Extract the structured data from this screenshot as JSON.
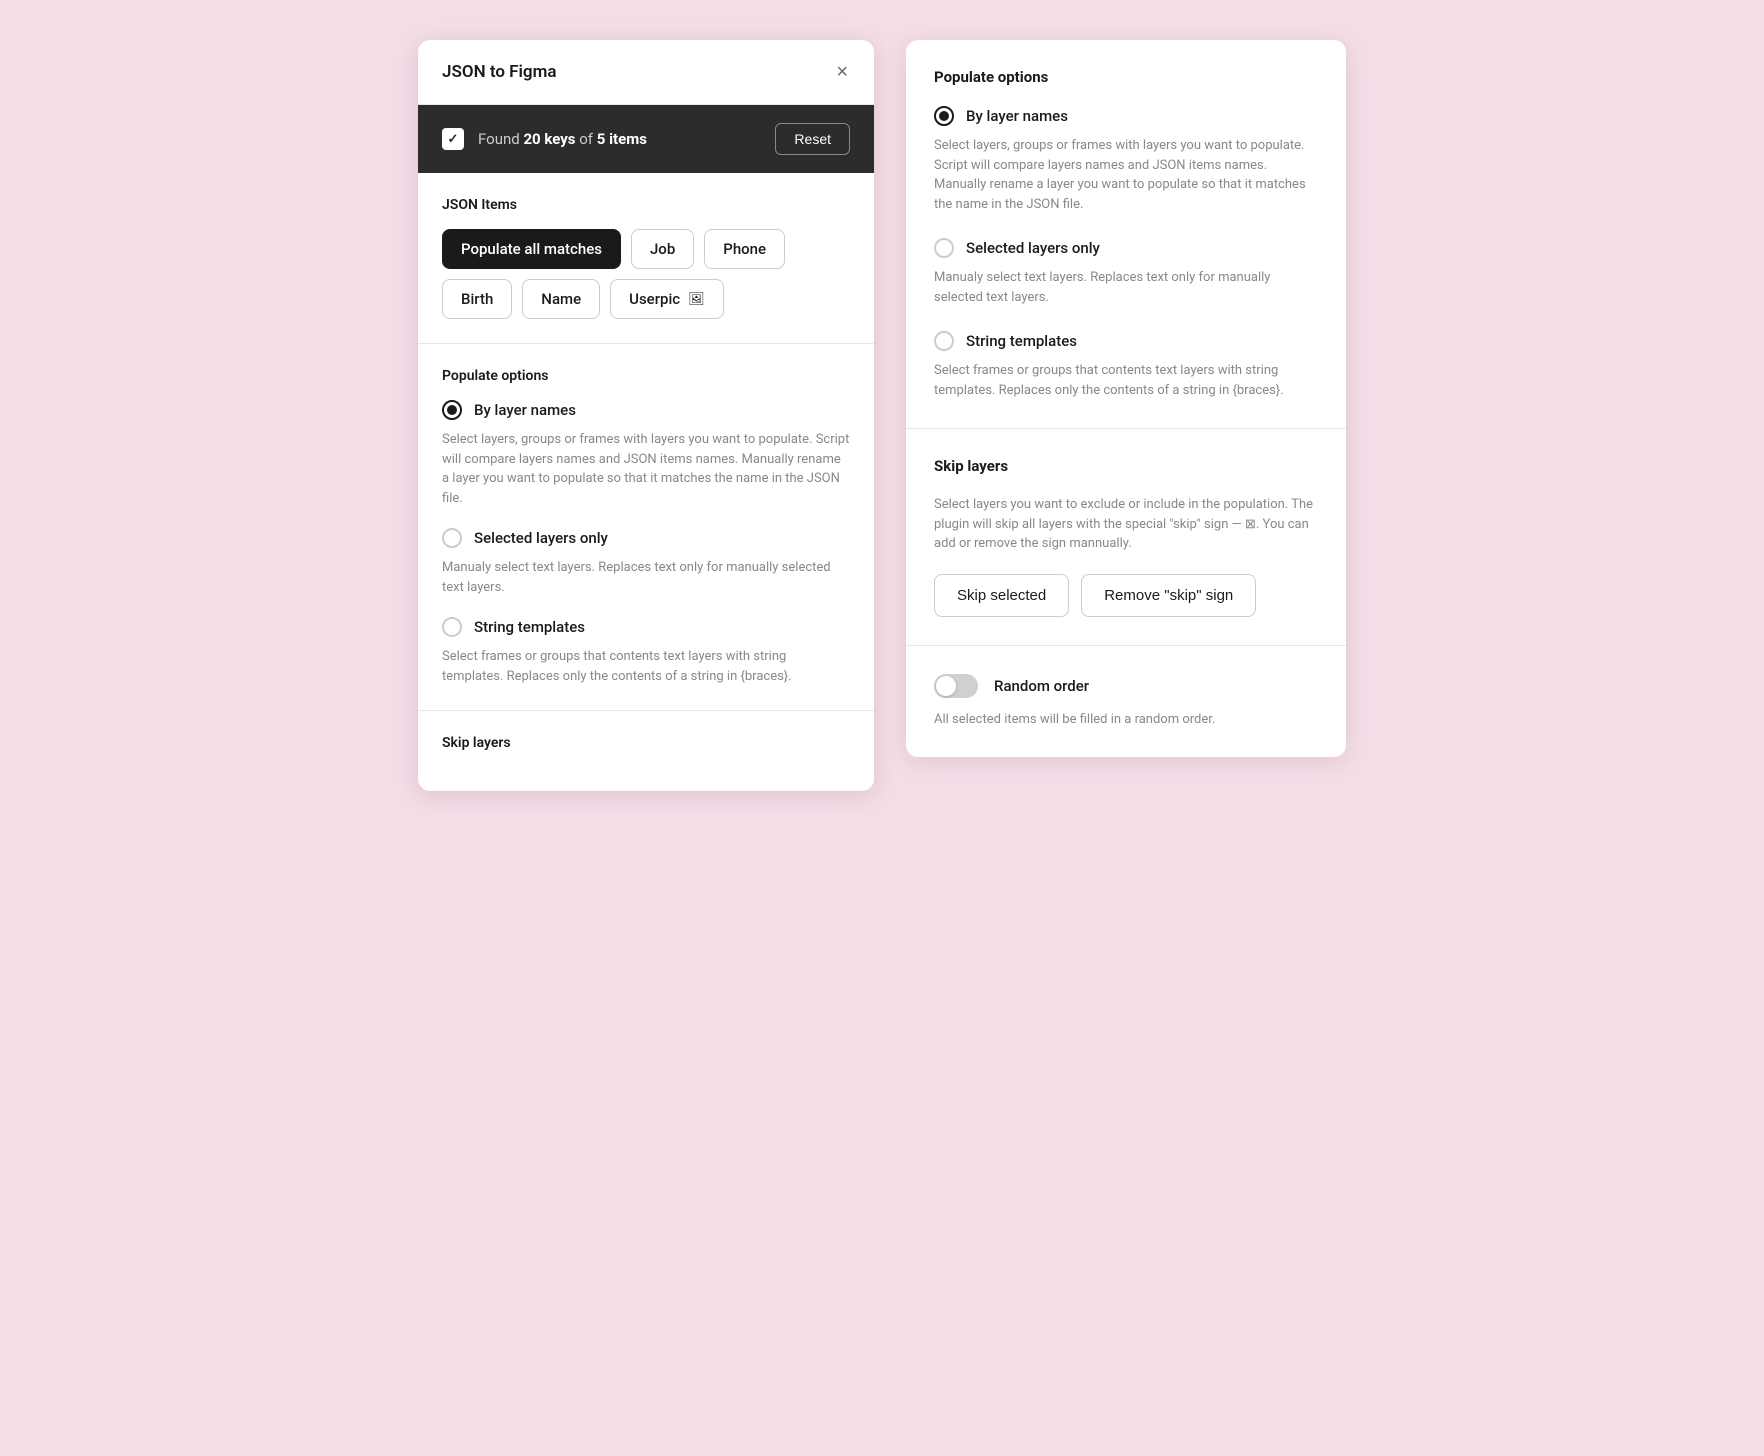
{
  "app": {
    "title": "JSON to Figma",
    "close_label": "×"
  },
  "found_bar": {
    "found_text_prefix": "Found ",
    "keys_count": "20 keys",
    "of_text": " of ",
    "items_count": "5 items",
    "reset_label": "Reset",
    "checkbox_aria": "select all"
  },
  "json_items": {
    "section_label": "JSON Items",
    "items": [
      {
        "label": "Populate all matches",
        "active": true,
        "has_icon": false
      },
      {
        "label": "Job",
        "active": false,
        "has_icon": false
      },
      {
        "label": "Phone",
        "active": false,
        "has_icon": false
      },
      {
        "label": "Birth",
        "active": false,
        "has_icon": false
      },
      {
        "label": "Name",
        "active": false,
        "has_icon": false
      },
      {
        "label": "Userpic",
        "active": false,
        "has_icon": true
      }
    ]
  },
  "populate_options": {
    "section_label": "Populate options",
    "options": [
      {
        "id": "by-layer-names",
        "label": "By layer names",
        "selected": true,
        "description": "Select layers, groups or frames with layers you want to populate. Script will compare layers names and JSON items names. Manually rename a layer you want to populate so that it matches the name in the JSON file."
      },
      {
        "id": "selected-layers-only",
        "label": "Selected layers only",
        "selected": false,
        "description": "Manualy select text layers. Replaces text only for manually selected text layers."
      },
      {
        "id": "string-templates",
        "label": "String templates",
        "selected": false,
        "description": "Select frames or groups that contents text layers with string templates. Replaces only the contents of a string in {braces}."
      }
    ]
  },
  "skip_layers": {
    "section_label": "Skip layers",
    "description": "Select layers you want to exclude or include in the population. The plugin will skip all layers with the special \"skip\" sign — ⊠. You can add or remove the sign mannually.",
    "skip_selected_label": "Skip selected",
    "remove_skip_label": "Remove \"skip\" sign"
  },
  "random_order": {
    "section_label": "Random order",
    "label": "Random order",
    "description": "All selected items will be filled in a random order.",
    "enabled": false
  },
  "right_panel": {
    "populate_options": {
      "title": "Populate options",
      "options": [
        {
          "id": "by-layer-names",
          "label": "By layer names",
          "selected": true,
          "description": "Select layers, groups or frames with layers you want to populate. Script will compare layers names and JSON items names. Manually rename a layer you want to populate so that it matches the name in the JSON file."
        },
        {
          "id": "selected-layers-only",
          "label": "Selected layers only",
          "selected": false,
          "description": "Manualy select text layers. Replaces text only for manually selected text layers."
        },
        {
          "id": "string-templates",
          "label": "String templates",
          "selected": false,
          "description": "Select frames or groups that contents text layers with string templates. Replaces only the contents of a string in {braces}."
        }
      ]
    },
    "skip_layers": {
      "title": "Skip layers",
      "description": "Select layers you want to exclude or include in the population. The plugin will skip all layers with the special \"skip\" sign — ⊠. You can add or remove the sign mannually.",
      "skip_selected_label": "Skip selected",
      "remove_skip_label": "Remove \"skip\" sign"
    },
    "random_order": {
      "label": "Random order",
      "description": "All selected items will be filled in a random order."
    }
  }
}
